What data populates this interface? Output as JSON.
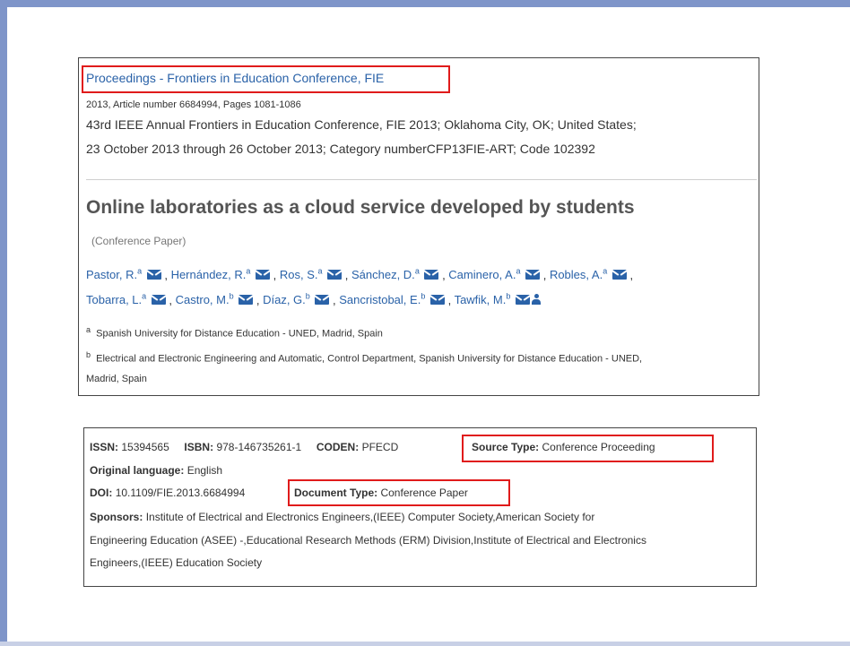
{
  "colors": {
    "link": "#2a62a8",
    "highlight": "#e01b1b",
    "frame": "#7f95c9"
  },
  "record": {
    "source_title": "Proceedings - Frontiers in Education Conference, FIE",
    "source_meta": "2013, Article number 6684994, Pages 1081-1086",
    "conference_line1": "43rd IEEE Annual Frontiers in Education Conference, FIE 2013; Oklahoma City, OK; United States;",
    "conference_line2": "23 October 2013 through 26 October 2013; Category numberCFP13FIE-ART; Code 102392",
    "title": "Online laboratories as a cloud service developed by students",
    "doc_type_tag": "(Conference Paper)",
    "authors": [
      {
        "name": "Pastor, R.",
        "sup": "a"
      },
      {
        "name": "Hernández, R.",
        "sup": "a"
      },
      {
        "name": "Ros, S.",
        "sup": "a"
      },
      {
        "name": "Sánchez, D.",
        "sup": "a"
      },
      {
        "name": "Caminero, A.",
        "sup": "a"
      },
      {
        "name": "Robles, A.",
        "sup": "a"
      },
      {
        "name": "Tobarra, L.",
        "sup": "a"
      },
      {
        "name": "Castro, M.",
        "sup": "b"
      },
      {
        "name": "Díaz, G.",
        "sup": "b"
      },
      {
        "name": "Sancristobal, E.",
        "sup": "b"
      },
      {
        "name": "Tawfik, M.",
        "sup": "b"
      }
    ],
    "affiliations": [
      {
        "sup": "a",
        "text": "Spanish University for Distance Education - UNED, Madrid, Spain"
      },
      {
        "sup": "b",
        "text_line1": "Electrical and Electronic Engineering and Automatic, Control Department, Spanish University for Distance Education - UNED,",
        "text_line2": "Madrid, Spain"
      }
    ]
  },
  "meta": {
    "issn_label": "ISSN:",
    "issn_value": "15394565",
    "isbn_label": "ISBN:",
    "isbn_value": "978-146735261-1",
    "coden_label": "CODEN:",
    "coden_value": "PFECD",
    "source_type_label": "Source Type:",
    "source_type_value": "Conference Proceeding",
    "language_label": "Original language:",
    "language_value": "English",
    "doi_label": "DOI:",
    "doi_value": "10.1109/FIE.2013.6684994",
    "document_type_label": "Document Type:",
    "document_type_value": "Conference Paper",
    "sponsors_label": "Sponsors:",
    "sponsors_line1": "Institute of Electrical and Electronics Engineers,(IEEE) Computer Society,American Society for",
    "sponsors_line2": "Engineering Education (ASEE) -,Educational Research Methods (ERM) Division,Institute of Electrical and Electronics",
    "sponsors_line3": "Engineers,(IEEE) Education Society"
  }
}
